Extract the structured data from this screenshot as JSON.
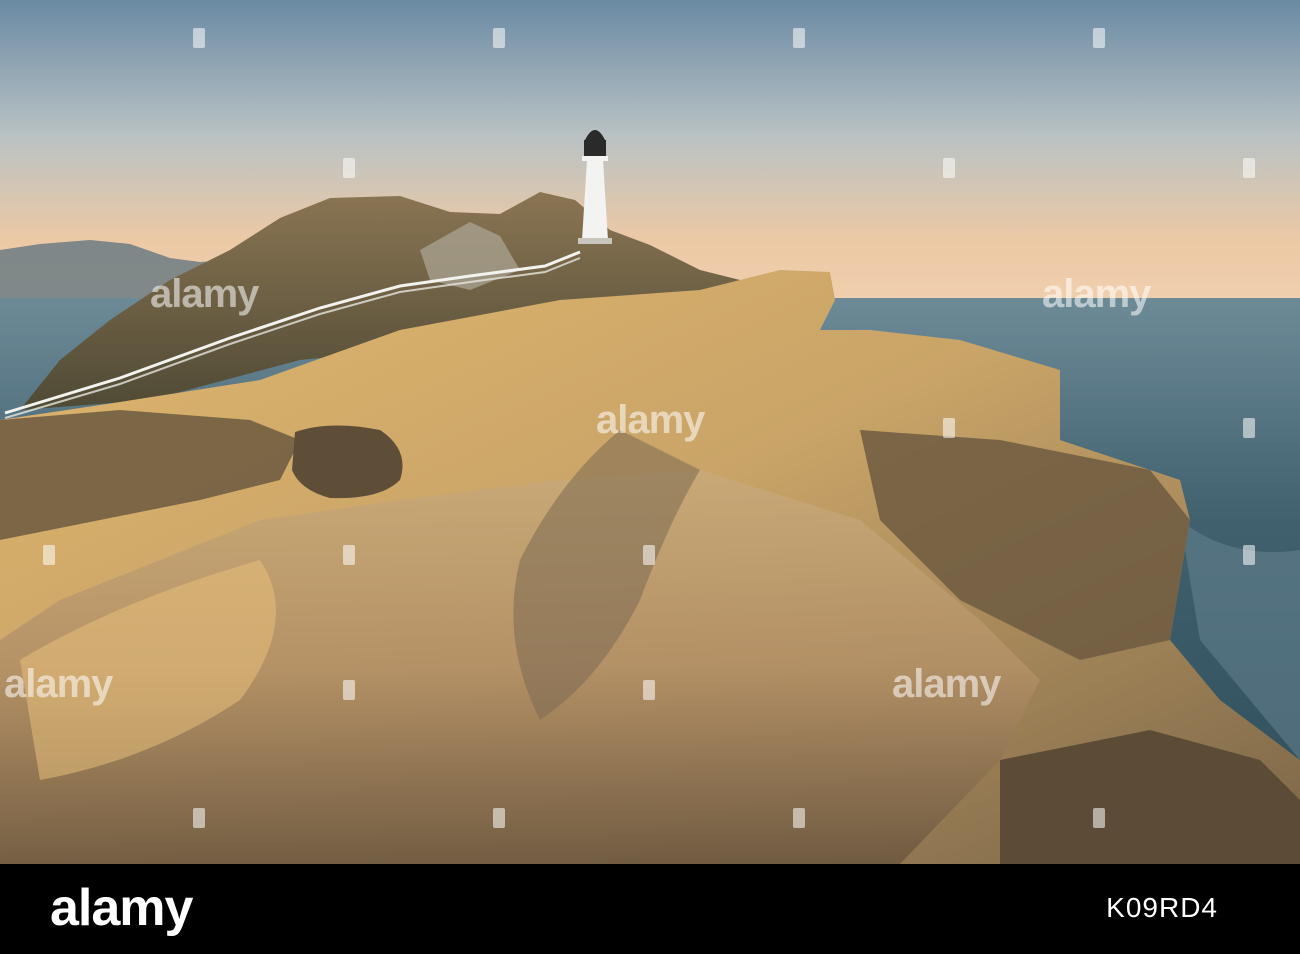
{
  "watermark": {
    "text": "alamy"
  },
  "footer": {
    "logo": "alamy",
    "image_id": "K09RD4"
  },
  "colors": {
    "sky_top": "#6f8ea6",
    "sky_horizon": "#f1c9a2",
    "sea": "#3f5f6d",
    "rock_light": "#d9b26e",
    "rock_dark": "#5a4a36",
    "lighthouse": "#f3f3f1",
    "footer_bg": "#000000"
  }
}
